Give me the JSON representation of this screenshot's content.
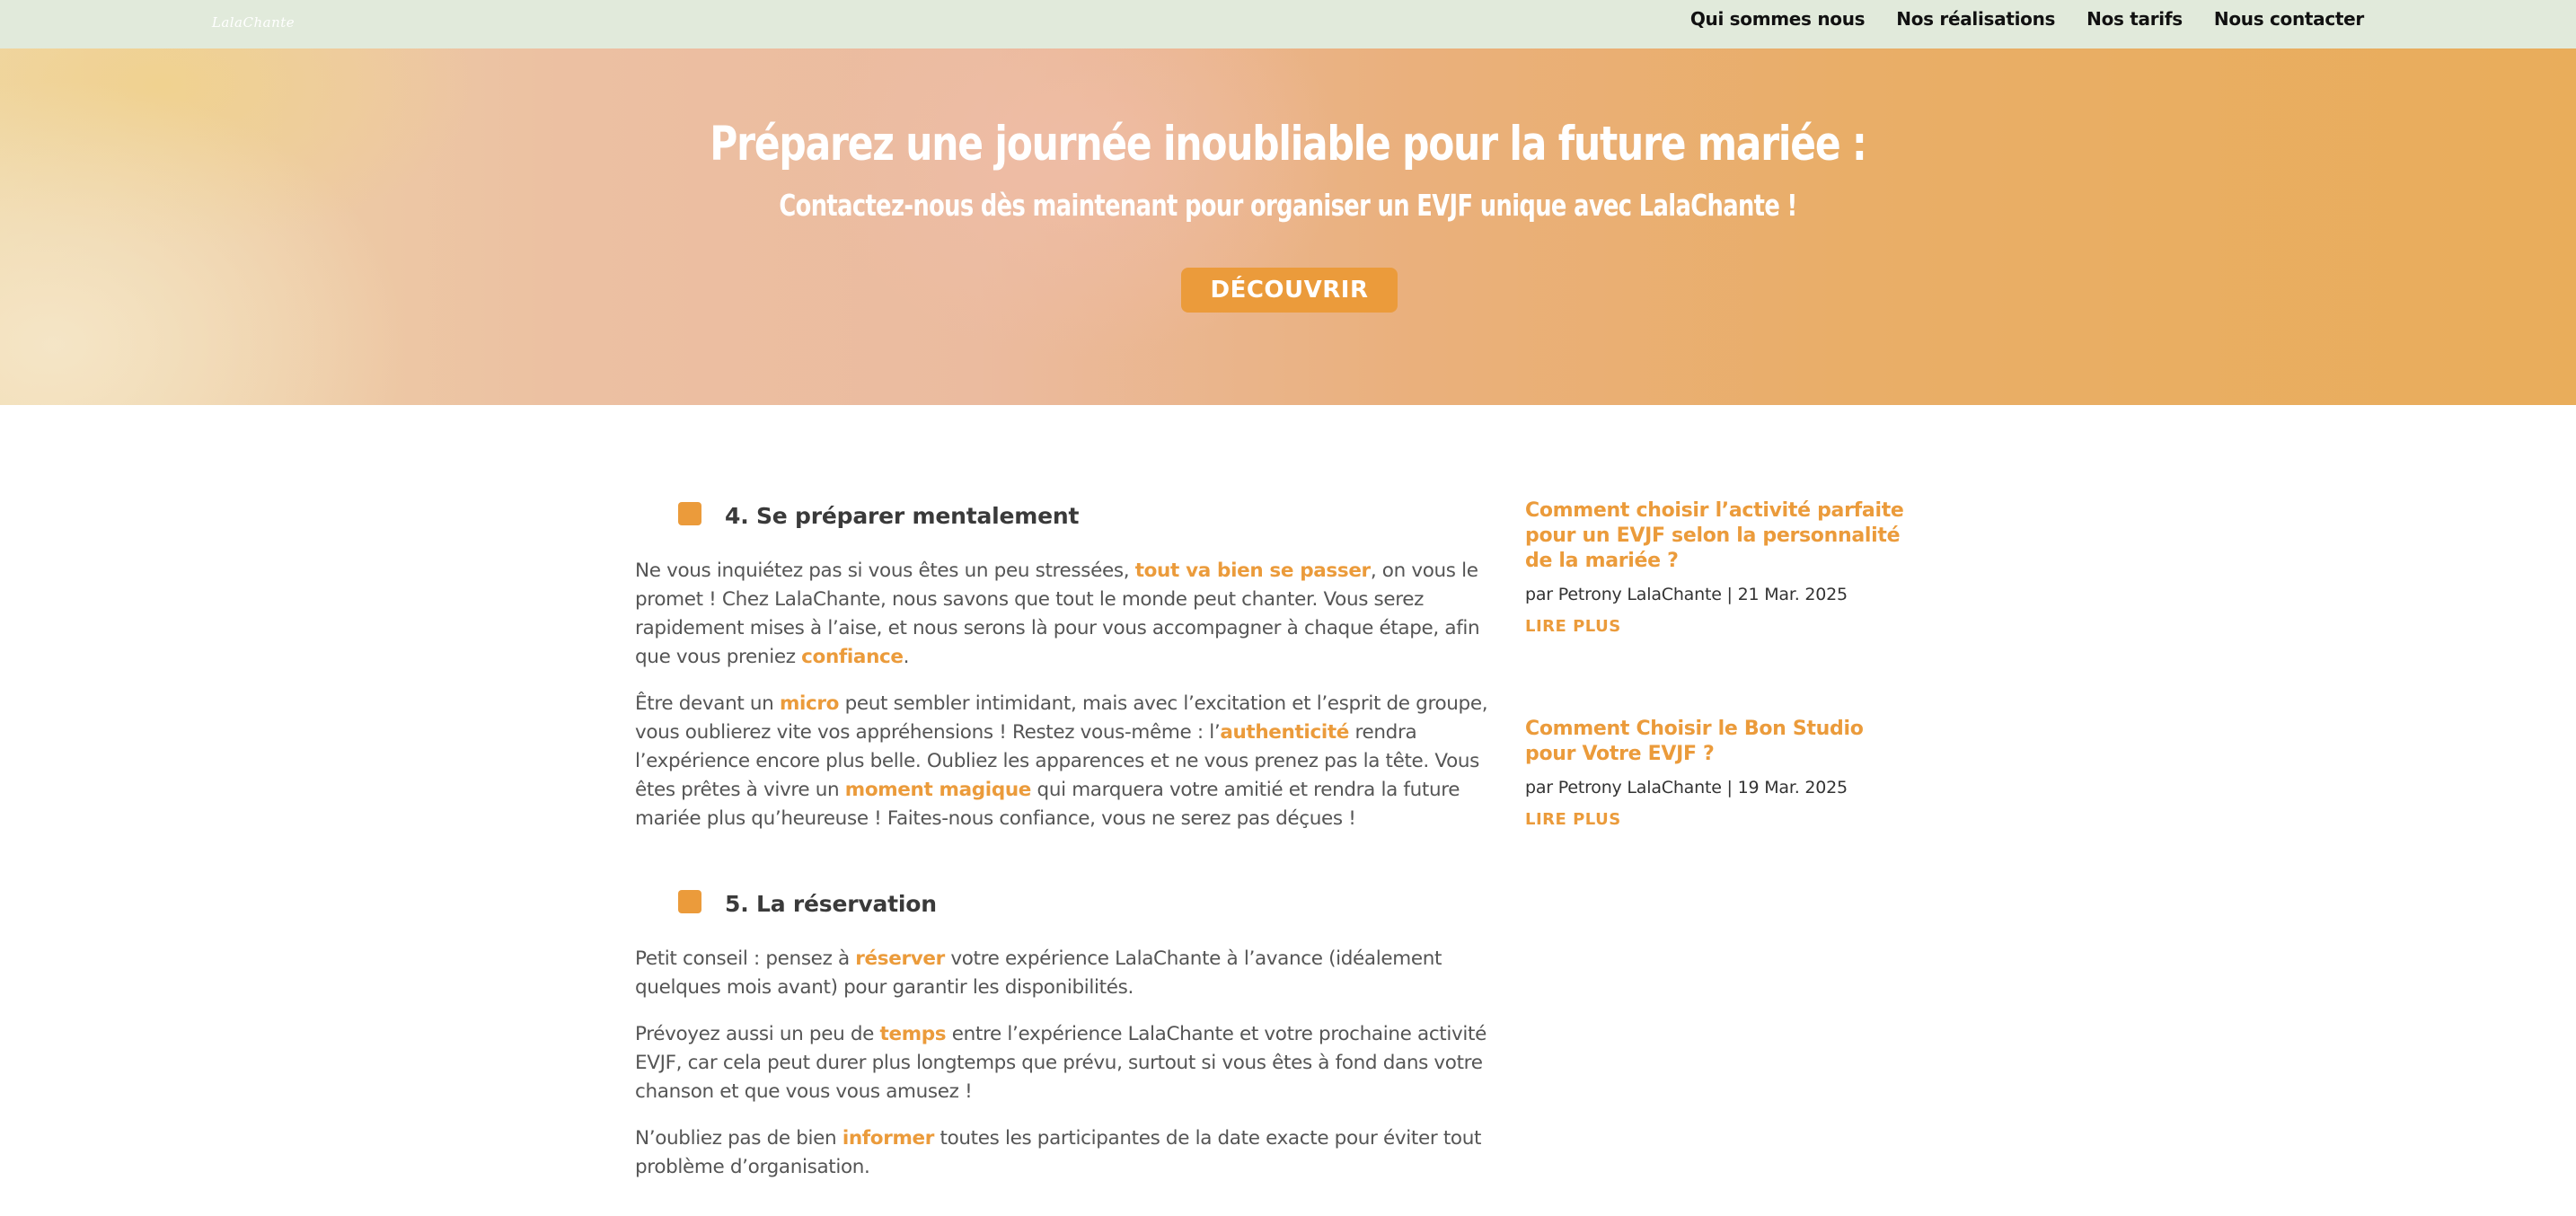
{
  "header": {
    "logo_text": "LalaChante",
    "nav": [
      {
        "label": "Qui sommes nous"
      },
      {
        "label": "Nos réalisations"
      },
      {
        "label": "Nos tarifs"
      },
      {
        "label": "Nous contacter"
      }
    ]
  },
  "hero": {
    "title": "Préparez une journée inoubliable pour la future mariée :",
    "subtitle": "Contactez-nous dès maintenant pour organiser un EVJF unique avec LalaChante !",
    "button_label": "DÉCOUVRIR"
  },
  "article": {
    "section4": {
      "title": "4. Se préparer mentalement",
      "p1": {
        "a": "Ne vous inquiétez pas si vous êtes un peu stressées, ",
        "b": "tout va bien se passer",
        "c": ", on vous le promet ! Chez LalaChante, nous savons que tout le monde peut chanter. Vous serez rapidement mises à l’aise, et nous serons là pour vous accompagner à chaque étape, afin que vous preniez ",
        "d": "confiance",
        "e": "."
      },
      "p2": {
        "a": "Être devant un ",
        "b": "micro",
        "c": " peut sembler intimidant, mais avec l’excitation et l’esprit de groupe, vous oublierez vite vos appréhensions ! Restez vous-même : l’",
        "d": "authenticité",
        "e": " rendra l’expérience encore plus belle. Oubliez les apparences et ne vous prenez pas la tête. Vous êtes prêtes à vivre un ",
        "f": "moment magique",
        "g": " qui marquera votre amitié et rendra la future mariée plus qu’heureuse ! Faites-nous confiance, vous ne serez pas déçues !"
      }
    },
    "section5": {
      "title": "5. La réservation",
      "p1": {
        "a": "Petit conseil : pensez à ",
        "b": "réserver",
        "c": " votre expérience LalaChante à l’avance (idéalement quelques mois avant) pour garantir les disponibilités."
      },
      "p2": {
        "a": "Prévoyez aussi un peu de ",
        "b": "temps",
        "c": " entre l’expérience LalaChante et votre prochaine activité EVJF, car cela peut durer plus longtemps que prévu, surtout si vous êtes à fond dans votre chanson et que vous vous amusez !"
      },
      "p3": {
        "a": "N’oubliez pas de bien ",
        "b": "informer",
        "c": " toutes les participantes de la date exacte pour éviter tout problème d’organisation."
      }
    }
  },
  "sidebar": {
    "posts": [
      {
        "title": "Comment choisir l’activité parfaite pour un EVJF selon la personnalité de la mariée ?",
        "meta": "par Petrony LalaChante | 21 Mar. 2025",
        "more": "LIRE PLUS"
      },
      {
        "title": "Comment Choisir le Bon Studio pour Votre EVJF ?",
        "meta": "par Petrony LalaChante | 19 Mar. 2025",
        "more": "LIRE PLUS"
      }
    ]
  },
  "colors": {
    "accent": "#eb9b3b",
    "nav_bg": "#e1eadb",
    "text": "#555555",
    "heading": "#3a3a3a"
  }
}
